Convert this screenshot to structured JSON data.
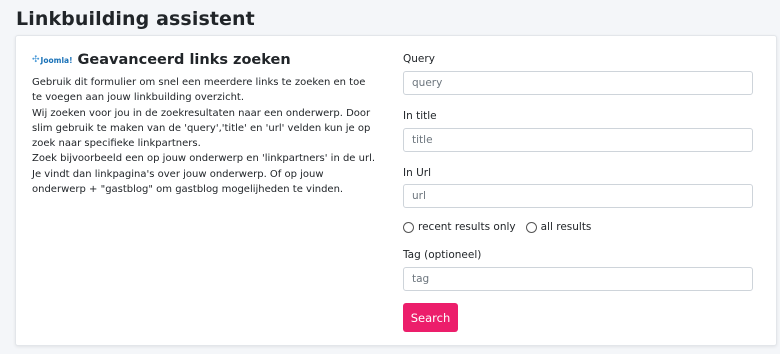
{
  "page": {
    "title": "Linkbuilding assistent"
  },
  "card": {
    "logo": {
      "brand": "Joomla!"
    },
    "title": "Geavanceerd links zoeken",
    "paragraphs": [
      "Gebruik dit formulier om snel een meerdere links te zoeken en toe te voegen aan jouw linkbuilding overzicht.",
      "Wij zoeken voor jou in de zoekresultaten naar een onderwerp. Door slim gebruik te maken van de 'query','title' en 'url' velden kun je op zoek naar specifieke linkpartners.",
      "Zoek bijvoorbeeld een op jouw onderwerp en 'linkpartners' in de url. Je vindt dan linkpagina's over jouw onderwerp. Of op jouw onderwerp + \"gastblog\" om gastblog mogelijheden te vinden."
    ]
  },
  "form": {
    "query": {
      "label": "Query",
      "placeholder": "query",
      "value": ""
    },
    "title": {
      "label": "In title",
      "placeholder": "title",
      "value": ""
    },
    "url": {
      "label": "In Url",
      "placeholder": "url",
      "value": ""
    },
    "results": {
      "options": [
        "recent results only",
        "all results"
      ]
    },
    "tag": {
      "label": "Tag (optioneel)",
      "placeholder": "tag",
      "value": ""
    },
    "submit_label": "Search"
  },
  "colors": {
    "accent": "#ec1e6b",
    "background": "#f4f6f9"
  }
}
